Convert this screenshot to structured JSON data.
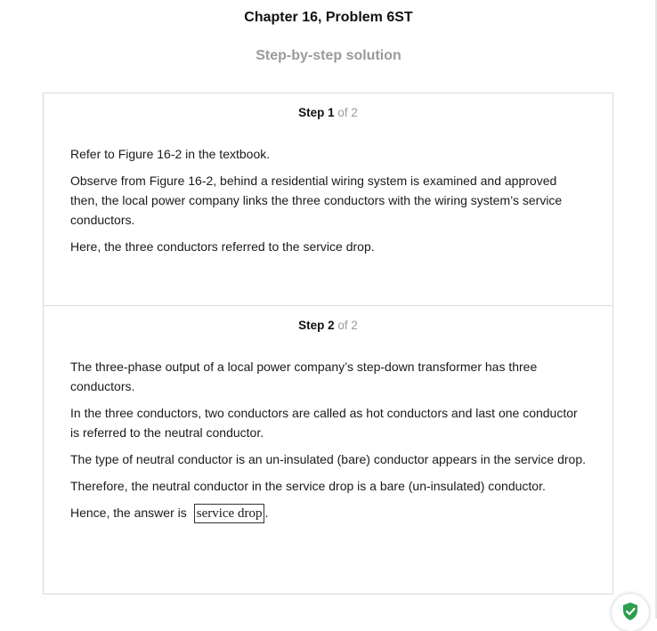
{
  "header": {
    "title": "Chapter 16, Problem 6ST",
    "subtitle": "Step-by-step solution"
  },
  "steps": [
    {
      "label": "Step 1",
      "of": "of 2",
      "paragraphs": [
        "Refer to Figure 16-2 in the textbook.",
        "Observe from Figure 16-2, behind a residential wiring system is examined and approved then, the local power company links the three conductors with the wiring system’s service conductors.",
        "Here, the three conductors referred to the service drop."
      ]
    },
    {
      "label": "Step 2",
      "of": "of 2",
      "paragraphs": [
        "The three-phase output of a local power company’s step-down transformer has three conductors.",
        "In the three conductors, two conductors are called as hot conductors and last one conductor is referred to the neutral conductor.",
        "The type of neutral conductor is an un-insulated (bare) conductor appears in the service drop.",
        "Therefore, the neutral conductor in the service drop is a bare (un-insulated) conductor."
      ],
      "answer_prefix": "Hence, the answer is",
      "answer": "service drop",
      "answer_suffix": "."
    }
  ],
  "badge": {
    "icon": "shield-check-icon",
    "color": "#2e9e4f"
  }
}
